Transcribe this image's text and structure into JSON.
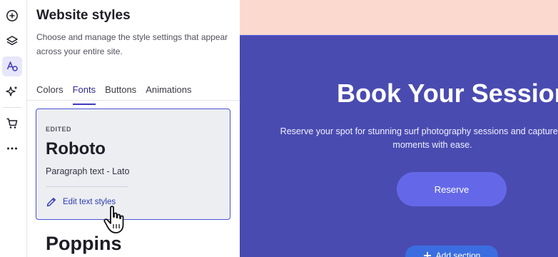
{
  "rail": {
    "items": [
      {
        "name": "add-icon",
        "active": false
      },
      {
        "name": "layers-icon",
        "active": false
      },
      {
        "name": "styles-icon",
        "active": true
      },
      {
        "name": "ai-sparkle-icon",
        "active": false
      },
      {
        "name": "cart-icon",
        "active": false
      },
      {
        "name": "more-icon",
        "active": false
      }
    ]
  },
  "panel": {
    "title": "Website styles",
    "description": "Choose and manage the style settings that appear across your entire site.",
    "tabs": [
      {
        "label": "Colors",
        "active": false
      },
      {
        "label": "Fonts",
        "active": true
      },
      {
        "label": "Buttons",
        "active": false
      },
      {
        "label": "Animations",
        "active": false
      }
    ],
    "font_card": {
      "badge": "EDITED",
      "heading_font": "Roboto",
      "paragraph_label": "Paragraph text - Lato",
      "edit_link": "Edit text styles"
    },
    "next_font": "Poppins"
  },
  "canvas": {
    "hero_title": "Book Your Session",
    "hero_description": "Reserve your spot for stunning surf photography sessions and capture ocean moments with ease.",
    "reserve_button": "Reserve",
    "add_section_button": "Add section"
  },
  "colors": {
    "accent": "#3f3bbd",
    "section_bg": "#4a4bb0",
    "reserve_bg": "#6468e8",
    "top_band": "#fbd9cf"
  }
}
